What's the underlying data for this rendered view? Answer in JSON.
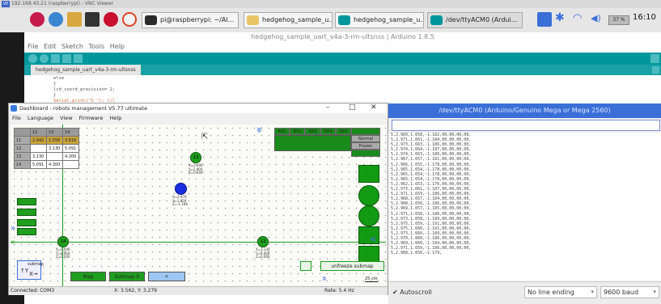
{
  "vnc": {
    "title": "192.168.43.21 (raspberrypi) - VNC Viewer",
    "logo": "VE"
  },
  "taskbar": {
    "windows": [
      "pi@raspberrypi: ~/Al...",
      "hedgehog_sample_u...",
      "hedgehog_sample_u...",
      "/dev/ttyACM0 (Ardui..."
    ],
    "volume": "37 %",
    "clock": "16:10"
  },
  "arduino": {
    "title": "hedgehog_sample_uart_v4a-3-rm-ultsnss | Arduino 1.8.5",
    "menu": [
      "File",
      "Edit",
      "Sketch",
      "Tools",
      "Help"
    ],
    "tab": "hedgehog_sample_uart_v4a-3-rm-ultsnss",
    "code": [
      "else",
      "{",
      "  lcd_coord_precision= 2;",
      "}",
      "Serial.print(\"S \"); //\\"
    ]
  },
  "serial": {
    "title": "/dev/ttyACM0 (Arduino/Genuino Mega or Mega 2560)",
    "lines": [
      "5,2.969,1.658,-1.182,00,00,00,00,",
      "5,2.971,1.661,-1.184,00,00,00,00,",
      "5,2.973,1.663,-1.186,00,00,00,00,",
      "5,2.974,1.664,-1.187,00,00,00,00,",
      "5,2.974,1.663,-1.186,00,00,00,00,",
      "5,2.967,1.657,-1.181,00,00,00,00,",
      "5,2.966,1.655,-1.178,00,00,00,00,",
      "5,2.965,1.654,-1.178,00,00,00,00,",
      "5,2.965,1.654,-1.178,00,00,00,00,",
      "5,2.965,1.654,-1.178,00,00,00,00,",
      "5,2.962,1.653,-1.176,00,00,00,00,",
      "5,2.973,1.661,-1.187,00,00,00,00,",
      "5,2.971,1.659,-1.186,00,00,00,00,",
      "5,2.968,1.657,-1.184,00,00,00,00,",
      "5,2.968,1.656,-1.186,00,00,00,00,",
      "5,2.969,1.657,-1.185,00,00,00,00,",
      "5,2.971,1.658,-1.186,00,00,00,00,",
      "5,2.973,1.658,-1.189,00,00,00,00,",
      "5,2.975,1.659,-1.191,00,00,00,00,",
      "5,2.975,1.660,-1.191,00,00,00,00,",
      "5,2.973,1.660,-1.189,00,00,00,00,",
      "5,2.970,1.660,-1.186,00,00,00,00,",
      "5,2.969,1.660,-1.184,00,00,00,00,",
      "5,2.971,1.659,-1.186,00,00,00,00,",
      "5,2.968,1.656,-1.179,"
    ],
    "autoscroll": "Autoscroll",
    "line_ending": "No line ending",
    "baud": "9600 baud"
  },
  "dashboard": {
    "title": "Dashboard - robots management  V5.77  ultimate",
    "menu": [
      "File",
      "Language",
      "View",
      "Firmware",
      "Help"
    ],
    "table": {
      "header": [
        "",
        "12",
        "13",
        "14"
      ],
      "rows": [
        [
          "11",
          "2.942",
          "1.556",
          "3.616"
        ],
        [
          "12",
          "",
          "3.130",
          "5.091"
        ],
        [
          "13",
          "3.130",
          "",
          "4.300"
        ],
        [
          "14",
          "5.091",
          "4.300",
          ""
        ]
      ]
    },
    "beacons": [
      {
        "id": "13",
        "coords": [
          "X=2.400",
          "Y=2.904",
          "Z=0.000"
        ]
      },
      {
        "id": "14",
        "coords": [
          "X=0.000",
          "Y=0.000",
          "Z=0.000"
        ]
      },
      {
        "id": "12",
        "coords": [
          "X=3.130",
          "Y=0.000",
          "Z=0.000"
        ]
      }
    ],
    "robot": {
      "coords": [
        "X=2.970",
        "Y=1.659",
        "Z=-1.186"
      ]
    },
    "radio_cols": [
      "RX1",
      "RX2",
      "RX3",
      "RX4",
      "RX5"
    ],
    "modes": [
      "Normal",
      "Frozen"
    ],
    "buttons": {
      "map": "Map",
      "submap": "Submap 0",
      "add": "+",
      "unfreeze": "unfreeze submap",
      "submap_small": "submap"
    },
    "scale": "25 cm",
    "status": {
      "connected": "Connected: COM3",
      "coords": "X: 3.562, Y: 3.279",
      "rate": "Rate: 5.4 Hz"
    }
  }
}
